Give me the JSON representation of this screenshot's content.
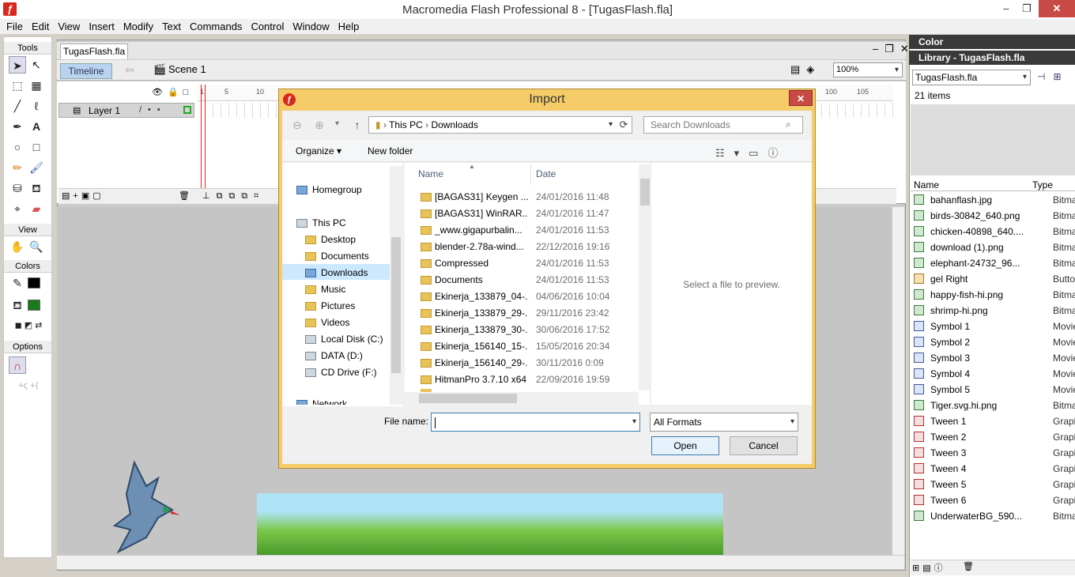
{
  "window": {
    "title": "Macromedia Flash Professional 8 - [TugasFlash.fla]"
  },
  "menu": [
    "File",
    "Edit",
    "View",
    "Insert",
    "Modify",
    "Text",
    "Commands",
    "Control",
    "Window",
    "Help"
  ],
  "tools": {
    "title": "Tools",
    "view": "View",
    "colors": "Colors",
    "options": "Options"
  },
  "document": {
    "tab": "TugasFlash.fla",
    "timeline_button": "Timeline",
    "scene": "Scene 1",
    "zoom": "100%",
    "layer": "Layer 1",
    "ruler_ticks": [
      "1",
      "5",
      "10",
      "100",
      "105"
    ]
  },
  "panels": {
    "color": "Color",
    "library_title": "Library - TugasFlash.fla",
    "library_doc": "TugasFlash.fla",
    "item_count": "21 items",
    "col_name": "Name",
    "col_type": "Type",
    "items": [
      {
        "name": "bahanflash.jpg",
        "type": "Bitmap",
        "kind": "bmp"
      },
      {
        "name": "birds-30842_640.png",
        "type": "Bitmap",
        "kind": "bmp"
      },
      {
        "name": "chicken-40898_640....",
        "type": "Bitmap",
        "kind": "bmp"
      },
      {
        "name": "download (1).png",
        "type": "Bitmap",
        "kind": "bmp"
      },
      {
        "name": "elephant-24732_96...",
        "type": "Bitmap",
        "kind": "bmp"
      },
      {
        "name": "gel Right",
        "type": "Button",
        "kind": "btn"
      },
      {
        "name": "happy-fish-hi.png",
        "type": "Bitmap",
        "kind": "bmp"
      },
      {
        "name": "shrimp-hi.png",
        "type": "Bitmap",
        "kind": "bmp"
      },
      {
        "name": "Symbol 1",
        "type": "Movie",
        "kind": "mc"
      },
      {
        "name": "Symbol 2",
        "type": "Movie",
        "kind": "mc"
      },
      {
        "name": "Symbol 3",
        "type": "Movie",
        "kind": "mc"
      },
      {
        "name": "Symbol 4",
        "type": "Movie",
        "kind": "mc"
      },
      {
        "name": "Symbol 5",
        "type": "Movie",
        "kind": "mc"
      },
      {
        "name": "Tiger.svg.hi.png",
        "type": "Bitmap",
        "kind": "bmp"
      },
      {
        "name": "Tween 1",
        "type": "Graph",
        "kind": "gr"
      },
      {
        "name": "Tween 2",
        "type": "Graph",
        "kind": "gr"
      },
      {
        "name": "Tween 3",
        "type": "Graph",
        "kind": "gr"
      },
      {
        "name": "Tween 4",
        "type": "Graph",
        "kind": "gr"
      },
      {
        "name": "Tween 5",
        "type": "Graph",
        "kind": "gr"
      },
      {
        "name": "Tween 6",
        "type": "Graph",
        "kind": "gr"
      },
      {
        "name": "UnderwaterBG_590...",
        "type": "Bitmap",
        "kind": "bmp"
      }
    ]
  },
  "dialog": {
    "title": "Import",
    "address": [
      "This PC",
      "Downloads"
    ],
    "search_placeholder": "Search Downloads",
    "organize": "Organize",
    "new_folder": "New folder",
    "nav": {
      "homegroup": "Homegroup",
      "this_pc": "This PC",
      "desktop": "Desktop",
      "documents": "Documents",
      "downloads": "Downloads",
      "music": "Music",
      "pictures": "Pictures",
      "videos": "Videos",
      "local_disk": "Local Disk (C:)",
      "data": "DATA (D:)",
      "cd": "CD Drive (F:)",
      "network": "Network"
    },
    "col_name": "Name",
    "col_date": "Date",
    "files": [
      {
        "name": "[BAGAS31] Keygen ...",
        "date": "24/01/2016 11:48"
      },
      {
        "name": "[BAGAS31] WinRAR...",
        "date": "24/01/2016 11:47"
      },
      {
        "name": "_www.gigapurbalin...",
        "date": "24/01/2016 11:53"
      },
      {
        "name": "blender-2.78a-wind...",
        "date": "22/12/2016 19:16"
      },
      {
        "name": "Compressed",
        "date": "24/01/2016 11:53"
      },
      {
        "name": "Documents",
        "date": "24/01/2016 11:53"
      },
      {
        "name": "Ekinerja_133879_04-...",
        "date": "04/06/2016 10:04"
      },
      {
        "name": "Ekinerja_133879_29-...",
        "date": "29/11/2016 23:42"
      },
      {
        "name": "Ekinerja_133879_30-...",
        "date": "30/06/2016 17:52"
      },
      {
        "name": "Ekinerja_156140_15-...",
        "date": "15/05/2016 20:34"
      },
      {
        "name": "Ekinerja_156140_29-...",
        "date": "30/11/2016 0:09"
      },
      {
        "name": "HitmanPro 3.7.10 x64",
        "date": "22/09/2016 19:59"
      }
    ],
    "preview_text": "Select a file to preview.",
    "file_name_label": "File name:",
    "file_name_value": "",
    "formats": "All Formats",
    "open": "Open",
    "cancel": "Cancel"
  }
}
